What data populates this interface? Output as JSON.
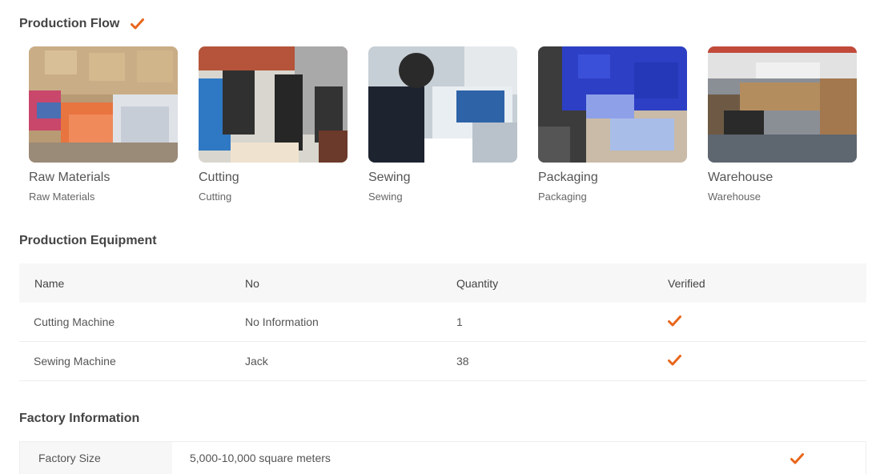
{
  "sections": {
    "production_flow": "Production Flow",
    "production_equipment": "Production Equipment",
    "factory_information": "Factory Information"
  },
  "accent_color": "#e8661b",
  "flow": [
    {
      "name": "Raw Materials",
      "sub": "Raw Materials"
    },
    {
      "name": "Cutting",
      "sub": "Cutting"
    },
    {
      "name": "Sewing",
      "sub": "Sewing"
    },
    {
      "name": "Packaging",
      "sub": "Packaging"
    },
    {
      "name": "Warehouse",
      "sub": "Warehouse"
    }
  ],
  "equipment": {
    "headers": {
      "name": "Name",
      "no": "No",
      "quantity": "Quantity",
      "verified": "Verified"
    },
    "rows": [
      {
        "name": "Cutting Machine",
        "no": "No Information",
        "quantity": "1",
        "verified": true
      },
      {
        "name": "Sewing Machine",
        "no": "Jack",
        "quantity": "38",
        "verified": true
      }
    ]
  },
  "factory": {
    "size_label": "Factory Size",
    "size_value": "5,000-10,000 square meters",
    "verified": true
  }
}
